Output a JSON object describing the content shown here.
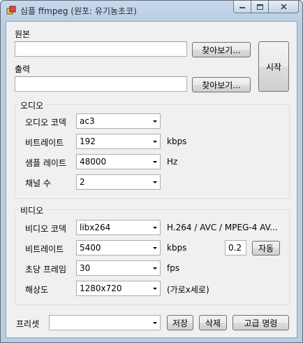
{
  "window": {
    "title": "심플 ffmpeg (원포: 유기농초코)"
  },
  "io": {
    "source_label": "원본",
    "source_value": "",
    "output_label": "출력",
    "output_value": "",
    "browse_label": "찾아보기...",
    "start_label": "시작"
  },
  "audio": {
    "group_title": "오디오",
    "codec_label": "오디오 코덱",
    "codec_value": "ac3",
    "bitrate_label": "비트레이트",
    "bitrate_value": "192",
    "bitrate_unit": "kbps",
    "samplerate_label": "샘플 레이트",
    "samplerate_value": "48000",
    "samplerate_unit": "Hz",
    "channels_label": "채널 수",
    "channels_value": "2"
  },
  "video": {
    "group_title": "비디오",
    "codec_label": "비디오 코덱",
    "codec_value": "libx264",
    "codec_desc": "H.264 / AVC / MPEG-4 AV...",
    "bitrate_label": "비트레이트",
    "bitrate_value": "5400",
    "bitrate_unit": "kbps",
    "factor_value": "0.2",
    "auto_label": "자동",
    "fps_label": "초당 프레임",
    "fps_value": "30",
    "fps_unit": "fps",
    "resolution_label": "해상도",
    "resolution_value": "1280x720",
    "resolution_unit": "(가로x세로)"
  },
  "preset": {
    "label": "프리셋",
    "value": "",
    "save_label": "저장",
    "delete_label": "삭제",
    "advanced_label": "고급 명령"
  }
}
